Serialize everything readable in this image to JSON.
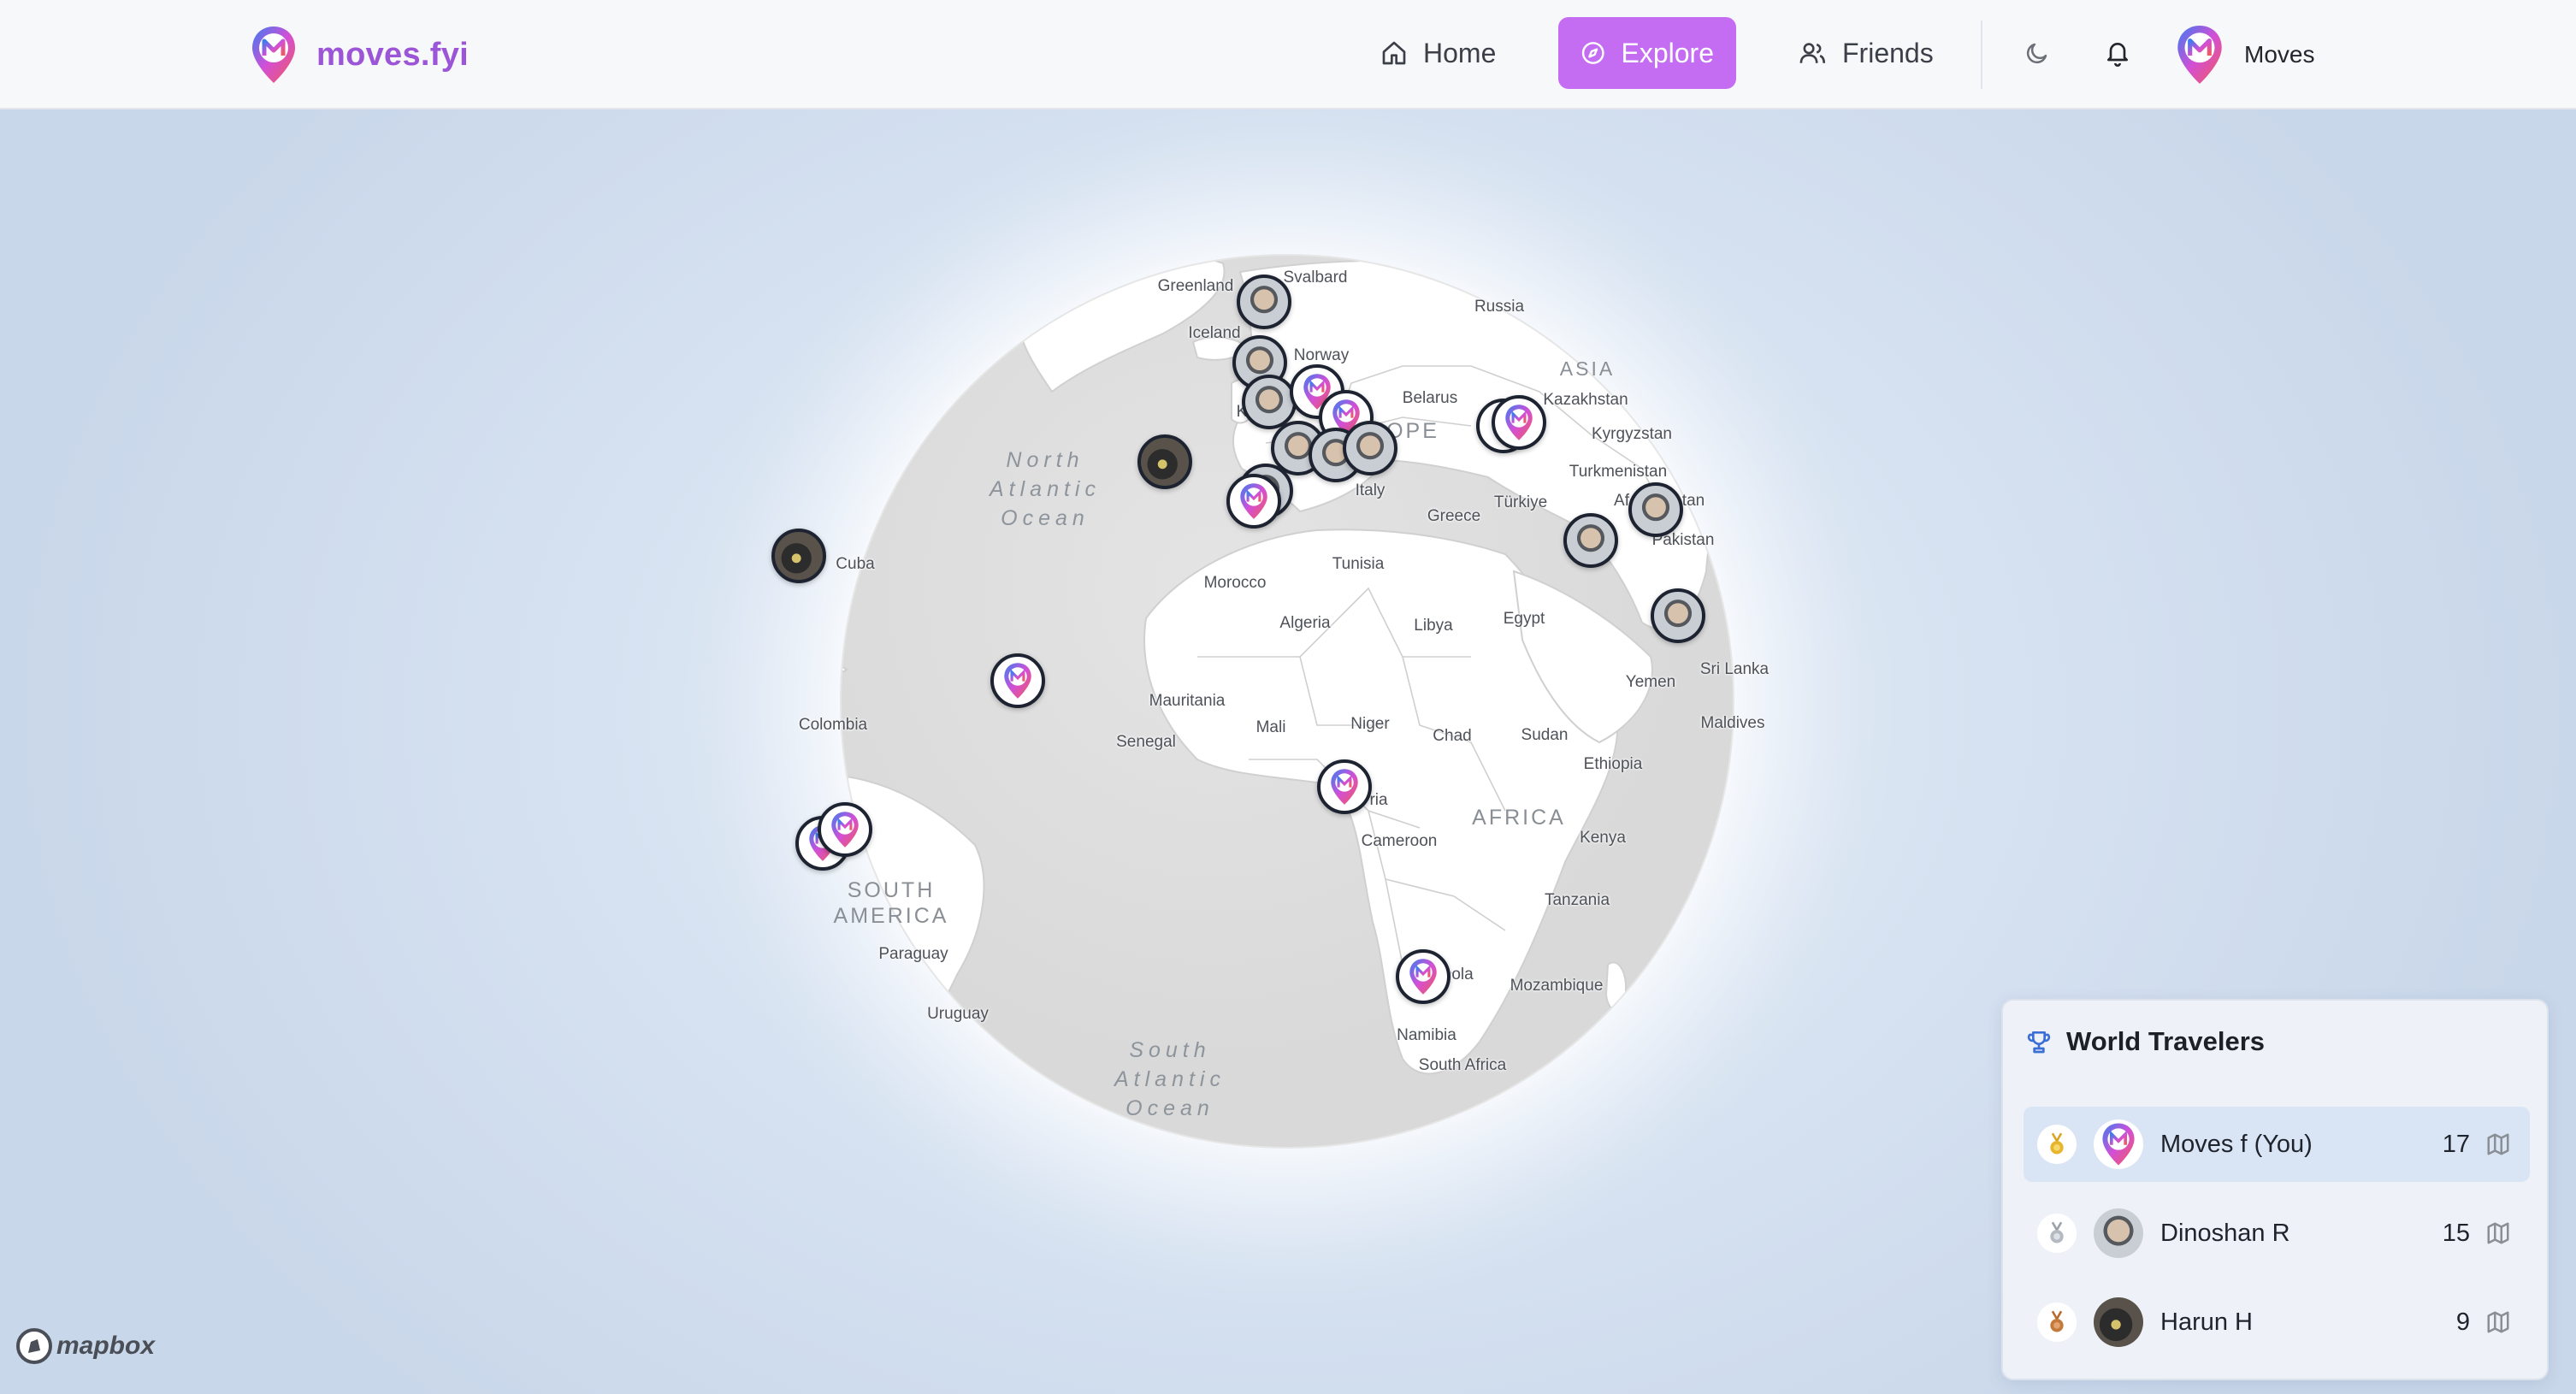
{
  "brand": {
    "name": "moves.fyi"
  },
  "nav": {
    "home": "Home",
    "explore": "Explore",
    "friends": "Friends"
  },
  "profile": {
    "name": "Moves"
  },
  "icons": {
    "home": "home-icon",
    "explore": "compass-icon",
    "friends": "users-icon",
    "theme": "moon-icon",
    "notifications": "bell-icon",
    "trophy": "trophy-icon",
    "map": "map-icon"
  },
  "colors": {
    "accent": "#c56df2",
    "brand_text": "#9b55d6",
    "gold": "#d9a520",
    "silver": "#9aa0a8",
    "bronze": "#b86a2e"
  },
  "map": {
    "labels": {
      "greenland": "Greenland",
      "svalbard": "Svalbard",
      "russia": "Russia",
      "iceland": "Iceland",
      "norway": "Norway",
      "belarus": "Belarus",
      "asia": "ASIA",
      "kazakhstan": "Kazakhstan",
      "kyrgyzstan": "Kyrgyzstan",
      "europe": "OPE",
      "turkmenistan": "Turkmenistan",
      "afghanistan_a": "Af",
      "afghanistan_b": "tan",
      "italy": "Italy",
      "turkiye": "Türkiye",
      "greece": "Greece",
      "pakistan": "Pakistan",
      "cuba": "Cuba",
      "morocco": "Morocco",
      "tunisia": "Tunisia",
      "algeria": "Algeria",
      "libya": "Libya",
      "egypt": "Egypt",
      "yemen": "Yemen",
      "sri_lanka": "Sri Lanka",
      "maldives": "Maldives",
      "colombia": "Colombia",
      "mauritania": "Mauritania",
      "mali": "Mali",
      "niger": "Niger",
      "chad": "Chad",
      "sudan": "Sudan",
      "senegal": "Senegal",
      "ethiopia": "Ethiopia",
      "nigeria_partial": "ria",
      "africa": "AFRICA",
      "cameroon": "Cameroon",
      "kenya": "Kenya",
      "tanzania": "Tanzania",
      "angola_partial": "ola",
      "mozambique": "Mozambique",
      "namibia": "Namibia",
      "south_africa": "South Africa",
      "paraguay": "Paraguay",
      "uruguay": "Uruguay",
      "uk_partial": "K"
    },
    "oceans": {
      "north_atlantic": "North\nAtlantic\nOcean",
      "south_atlantic": "South\nAtlantic\nOcean"
    },
    "regions": {
      "south_america": "SOUTH\nAMERICA"
    },
    "attribution": "mapbox"
  },
  "leaderboard": {
    "title": "World Travelers",
    "entries": [
      {
        "rank": 1,
        "name": "Moves f (You)",
        "count": "17",
        "medal": "gold"
      },
      {
        "rank": 2,
        "name": "Dinoshan R",
        "count": "15",
        "medal": "silver"
      },
      {
        "rank": 3,
        "name": "Harun H",
        "count": "9",
        "medal": "bronze"
      }
    ]
  }
}
